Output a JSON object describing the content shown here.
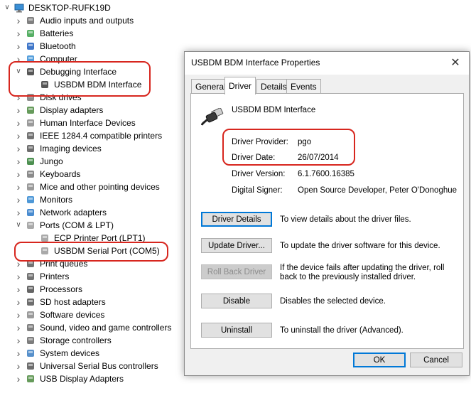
{
  "tree": {
    "root": "DESKTOP-RUFK19D",
    "items": [
      {
        "label": "Audio inputs and outputs",
        "icon": "speaker-icon",
        "expanded": false
      },
      {
        "label": "Batteries",
        "icon": "battery-icon",
        "expanded": false
      },
      {
        "label": "Bluetooth",
        "icon": "bluetooth-icon",
        "expanded": false
      },
      {
        "label": "Computer",
        "icon": "computer-icon",
        "expanded": false
      },
      {
        "label": "Debugging Interface",
        "icon": "usb-plug-icon",
        "expanded": true
      },
      {
        "label": "USBDM BDM Interface",
        "icon": "usb-plug-icon",
        "child": true
      },
      {
        "label": "Disk drives",
        "icon": "disk-icon",
        "expanded": false
      },
      {
        "label": "Display adapters",
        "icon": "display-adapter-icon",
        "expanded": false
      },
      {
        "label": "Human Interface Devices",
        "icon": "hid-icon",
        "expanded": false
      },
      {
        "label": "IEEE 1284.4 compatible printers",
        "icon": "printer-icon",
        "expanded": false
      },
      {
        "label": "Imaging devices",
        "icon": "camera-icon",
        "expanded": false
      },
      {
        "label": "Jungo",
        "icon": "jungo-icon",
        "expanded": false
      },
      {
        "label": "Keyboards",
        "icon": "keyboard-icon",
        "expanded": false
      },
      {
        "label": "Mice and other pointing devices",
        "icon": "mouse-icon",
        "expanded": false
      },
      {
        "label": "Monitors",
        "icon": "monitor-icon",
        "expanded": false
      },
      {
        "label": "Network adapters",
        "icon": "network-icon",
        "expanded": false
      },
      {
        "label": "Ports (COM & LPT)",
        "icon": "port-icon",
        "expanded": true
      },
      {
        "label": "ECP Printer Port (LPT1)",
        "icon": "port-icon",
        "child": true
      },
      {
        "label": "USBDM Serial Port (COM5)",
        "icon": "port-icon",
        "child": true
      },
      {
        "label": "Print queues",
        "icon": "printer-icon",
        "expanded": false
      },
      {
        "label": "Printers",
        "icon": "printer-icon",
        "expanded": false
      },
      {
        "label": "Processors",
        "icon": "processor-icon",
        "expanded": false
      },
      {
        "label": "SD host adapters",
        "icon": "sd-card-icon",
        "expanded": false
      },
      {
        "label": "Software devices",
        "icon": "software-device-icon",
        "expanded": false
      },
      {
        "label": "Sound, video and game controllers",
        "icon": "speaker-icon",
        "expanded": false
      },
      {
        "label": "Storage controllers",
        "icon": "storage-controller-icon",
        "expanded": false
      },
      {
        "label": "System devices",
        "icon": "system-device-icon",
        "expanded": false
      },
      {
        "label": "Universal Serial Bus controllers",
        "icon": "usb-controller-icon",
        "expanded": false
      },
      {
        "label": "USB Display Adapters",
        "icon": "display-adapter-icon",
        "expanded": false
      }
    ]
  },
  "dialog": {
    "title": "USBDM BDM Interface Properties",
    "close": "✕",
    "tabs": [
      "General",
      "Driver",
      "Details",
      "Events"
    ],
    "active_tab": "Driver",
    "device_name": "USBDM BDM Interface",
    "fields": [
      {
        "label": "Driver Provider:",
        "value": "pgo"
      },
      {
        "label": "Driver Date:",
        "value": "26/07/2014"
      },
      {
        "label": "Driver Version:",
        "value": "6.1.7600.16385"
      },
      {
        "label": "Digital Signer:",
        "value": "Open Source Developer, Peter O'Donoghue"
      }
    ],
    "actions": [
      {
        "label": "Driver Details",
        "desc": "To view details about the driver files.",
        "enabled": true
      },
      {
        "label": "Update Driver...",
        "desc": "To update the driver software for this device.",
        "enabled": true
      },
      {
        "label": "Roll Back Driver",
        "desc": "If the device fails after updating the driver, roll back to the previously installed driver.",
        "enabled": false
      },
      {
        "label": "Disable",
        "desc": "Disables the selected device.",
        "enabled": true
      },
      {
        "label": "Uninstall",
        "desc": "To uninstall the driver (Advanced).",
        "enabled": true
      }
    ],
    "ok": "OK",
    "cancel": "Cancel"
  },
  "colors": {
    "highlight": "#d7261e",
    "accent": "#0078d7"
  }
}
